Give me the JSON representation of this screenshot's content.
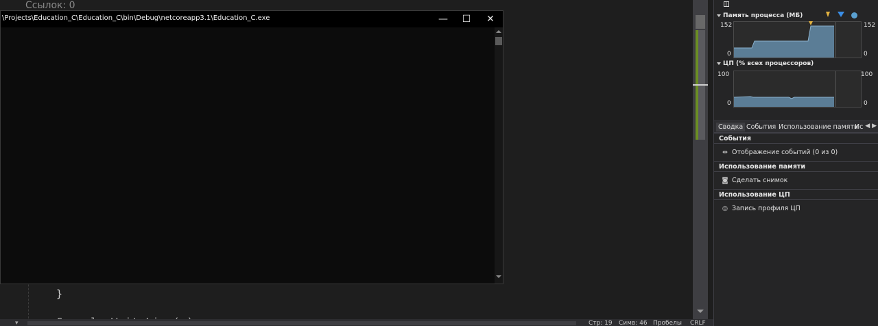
{
  "editor": {
    "references": "Ссылок: 0",
    "closing_brace": "}",
    "cut_off_line": "Console.WriteLine(a);"
  },
  "console": {
    "title": "\\Projects\\Education_C\\Education_C\\bin\\Debug\\netcoreapp3.1\\Education_C.exe",
    "minimize": "—",
    "maximize": "☐",
    "close": "✕"
  },
  "status": {
    "line": "Стр: 19",
    "char": "Симв: 46",
    "spaces": "Пробелы",
    "eol": "CRLF"
  },
  "diagnostics": {
    "memory": {
      "title": "Память процесса (МБ)",
      "ymax_left": "152",
      "ymin_left": "0",
      "ymax_right": "152",
      "ymin_right": "0",
      "colors": {
        "fill": "#5b7d96",
        "marker_gc": "#e3b341",
        "marker_snapshot": "#3a8ee6",
        "marker_dot": "#5aa0d0"
      }
    },
    "cpu": {
      "title": "ЦП (% всех процессоров)",
      "ymax_left": "100",
      "ymin_left": "0",
      "ymax_right": "100",
      "ymin_right": "0"
    },
    "tabs": [
      {
        "label": "Сводка"
      },
      {
        "label": "События"
      },
      {
        "label": "Использование памяти"
      },
      {
        "label": "Ис"
      }
    ],
    "tab_arrows": "◀ ▶",
    "groups": {
      "events": {
        "title": "События",
        "item": "Отображение событий (0 из 0)",
        "icon": "events-icon"
      },
      "memory": {
        "title": "Использование памяти",
        "item": "Сделать снимок",
        "icon": "camera-icon"
      },
      "cpu": {
        "title": "Использование ЦП",
        "item": "Запись профиля ЦП",
        "icon": "record-icon"
      }
    }
  }
}
